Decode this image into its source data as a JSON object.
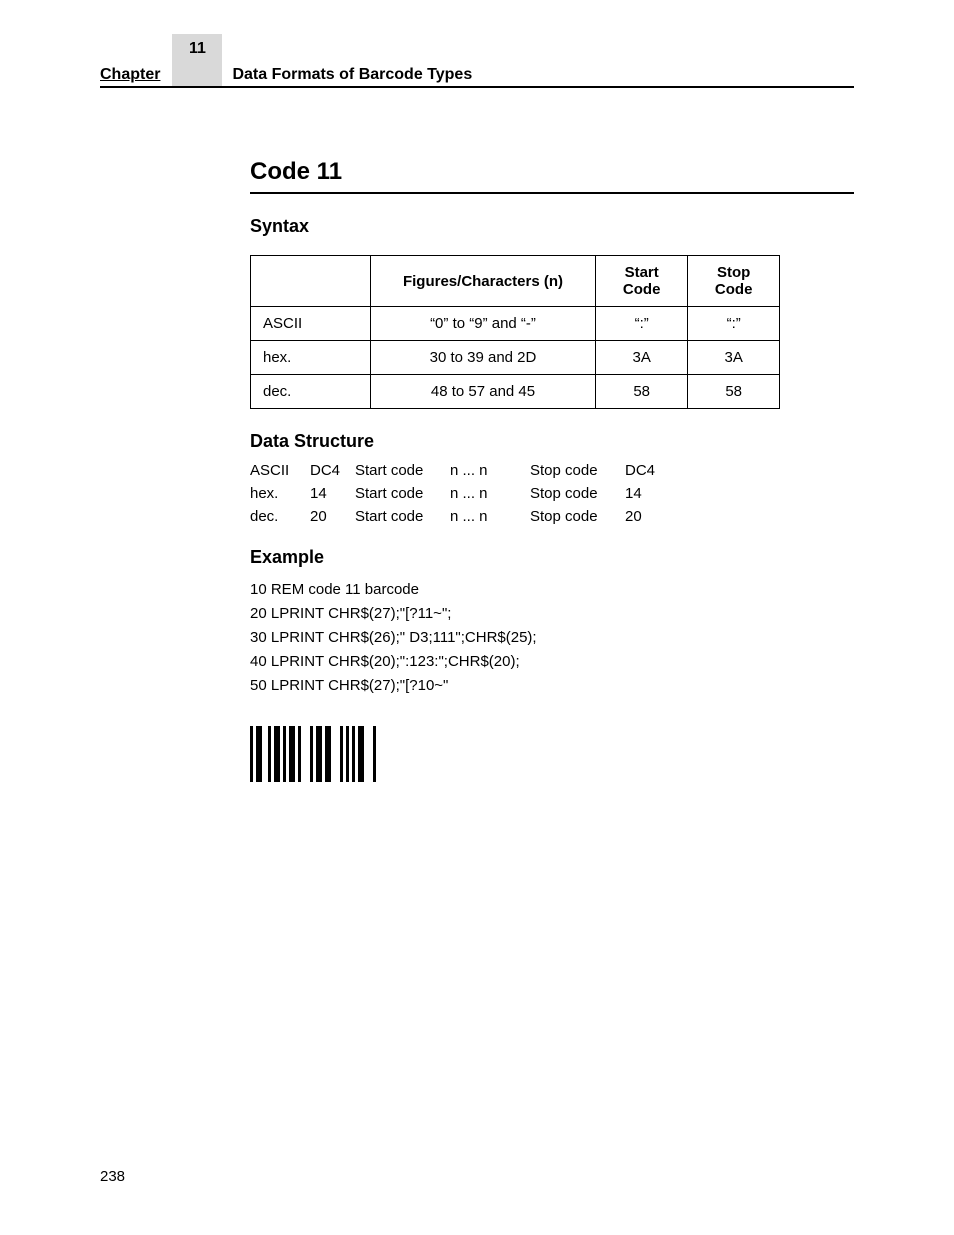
{
  "header": {
    "chapter_label": "Chapter",
    "chapter_number": "11",
    "title": "Data Formats of Barcode Types"
  },
  "section_title": "Code 11",
  "syntax": {
    "heading": "Syntax",
    "col_figures": "Figures/Characters (n)",
    "col_start": "Start Code",
    "col_stop": "Stop Code",
    "rows": [
      {
        "label": "ASCII",
        "figures": "“0” to “9” and “-”",
        "start": "“:”",
        "stop": "“:”"
      },
      {
        "label": "hex.",
        "figures": "30 to 39 and 2D",
        "start": "3A",
        "stop": "3A"
      },
      {
        "label": "dec.",
        "figures": "48 to 57 and 45",
        "start": "58",
        "stop": "58"
      }
    ]
  },
  "data_structure": {
    "heading": "Data Structure",
    "rows": [
      {
        "c0": "ASCII",
        "c1": "DC4",
        "c2": "Start code",
        "c3": "n ... n",
        "c4": "Stop code",
        "c5": "DC4"
      },
      {
        "c0": "hex.",
        "c1": "14",
        "c2": "Start code",
        "c3": "n ... n",
        "c4": "Stop code",
        "c5": "14"
      },
      {
        "c0": "dec.",
        "c1": "20",
        "c2": "Start code",
        "c3": "n ... n",
        "c4": "Stop code",
        "c5": "20"
      }
    ]
  },
  "example": {
    "heading": "Example",
    "lines": [
      "10 REM code 11 barcode",
      "20 LPRINT CHR$(27);\"[?11~\";",
      "30 LPRINT CHR$(26);\" D3;111\";CHR$(25);",
      "40 LPRINT CHR$(20);\":123:\";CHR$(20);",
      "50 LPRINT CHR$(27);\"[?10~\""
    ]
  },
  "page_number": "238"
}
